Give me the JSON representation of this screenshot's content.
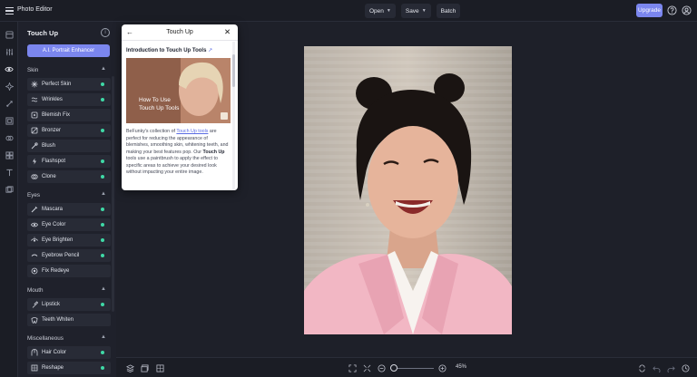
{
  "app": {
    "title": "Photo Editor"
  },
  "topbar": {
    "open_label": "Open",
    "save_label": "Save",
    "batch_label": "Batch",
    "upgrade_label": "Upgrade"
  },
  "panel": {
    "title": "Touch Up",
    "info_icon_text": "i",
    "ai_button_label": "A.I. Portrait Enhancer",
    "sections": [
      {
        "label": "Skin",
        "tools": [
          {
            "label": "Perfect Skin",
            "icon": "perfect-skin-icon",
            "dot": true
          },
          {
            "label": "Wrinkles",
            "icon": "wrinkles-icon",
            "dot": true
          },
          {
            "label": "Blemish Fix",
            "icon": "blemish-icon",
            "dot": false
          },
          {
            "label": "Bronzer",
            "icon": "bronzer-icon",
            "dot": true
          },
          {
            "label": "Blush",
            "icon": "blush-icon",
            "dot": false
          },
          {
            "label": "Flashspot",
            "icon": "flashspot-icon",
            "dot": true
          },
          {
            "label": "Clone",
            "icon": "clone-icon",
            "dot": true
          }
        ]
      },
      {
        "label": "Eyes",
        "tools": [
          {
            "label": "Mascara",
            "icon": "mascara-icon",
            "dot": true
          },
          {
            "label": "Eye Color",
            "icon": "eye-color-icon",
            "dot": true
          },
          {
            "label": "Eye Brighten",
            "icon": "eye-brighten-icon",
            "dot": true
          },
          {
            "label": "Eyebrow Pencil",
            "icon": "eyebrow-pencil-icon",
            "dot": true
          },
          {
            "label": "Fix Redeye",
            "icon": "redeye-icon",
            "dot": false
          }
        ]
      },
      {
        "label": "Mouth",
        "tools": [
          {
            "label": "Lipstick",
            "icon": "lipstick-icon",
            "dot": true
          },
          {
            "label": "Teeth Whiten",
            "icon": "teeth-icon",
            "dot": false
          }
        ]
      },
      {
        "label": "Miscellaneous",
        "tools": [
          {
            "label": "Hair Color",
            "icon": "hair-color-icon",
            "dot": true
          },
          {
            "label": "Reshape",
            "icon": "reshape-icon",
            "dot": true
          }
        ]
      }
    ]
  },
  "popup": {
    "title": "Touch Up",
    "subtitle": "Introduction to Touch Up Tools",
    "thumb_caption_line1": "How To Use",
    "thumb_caption_line2": "Touch Up Tools",
    "body_part1": "BeFunky's collection of ",
    "body_link": "Touch Up tools",
    "body_part2": " are perfect for reducing the appearance of blemishes, smoothing skin, whitening teeth, and making your best features pop. Our ",
    "body_bold": "Touch Up",
    "body_part3": " tools use a paintbrush to apply the effect to specific areas to achieve your desired look without impacting your entire image."
  },
  "zoom": {
    "value_label": "45%",
    "level": 0.45
  },
  "colors": {
    "accent": "#7b86ee",
    "dot": "#3fd9a6",
    "panel_bg": "#1f212b",
    "tool_bg": "#282b36"
  }
}
